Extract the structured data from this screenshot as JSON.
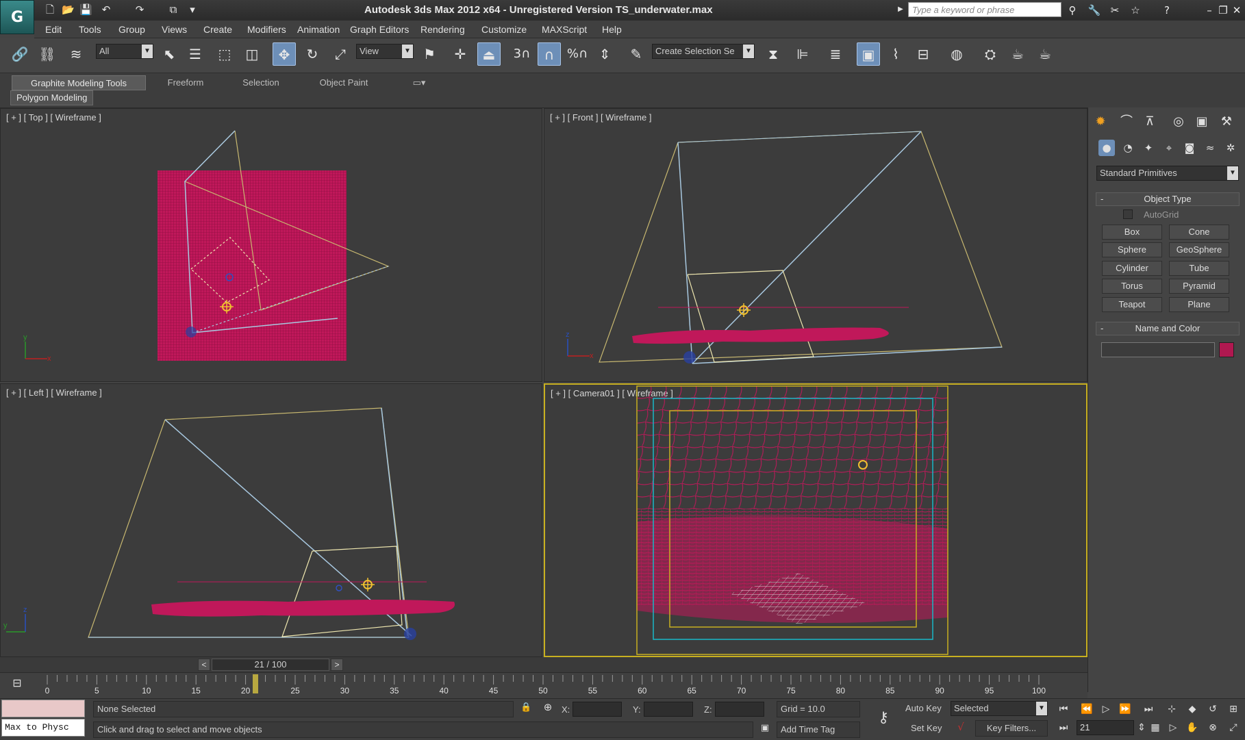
{
  "title_bar": {
    "title": "Autodesk 3ds Max  2012 x64  -  Unregistered Version    TS_underwater.max",
    "search_placeholder": "Type a keyword or phrase",
    "logo_text": "G"
  },
  "menu": [
    "Edit",
    "Tools",
    "Group",
    "Views",
    "Create",
    "Modifiers",
    "Animation",
    "Graph Editors",
    "Rendering",
    "Customize",
    "MAXScript",
    "Help"
  ],
  "toolbar": {
    "selection_filter": "All",
    "reference_coord": "View",
    "named_selection_placeholder": "Create Selection Se",
    "snap_label": "3",
    "angle_snap_label": "%"
  },
  "ribbon": {
    "tabs": [
      "Graphite Modeling Tools",
      "Freeform",
      "Selection",
      "Object Paint"
    ],
    "panel": "Polygon Modeling"
  },
  "viewports": {
    "top_label": "[ + ] [ Top ] [ Wireframe ]",
    "front_label": "[ + ] [ Front ] [ Wireframe ]",
    "left_label": "[ + ] [ Left ] [ Wireframe ]",
    "camera_label": "[ + ] [ Camera01 ] [ Wireframe ]",
    "axis_x": "x",
    "axis_y": "y",
    "axis_z": "z"
  },
  "command_panel": {
    "category_dropdown": "Standard Primitives",
    "object_type_title": "Object Type",
    "autogrid_label": "AutoGrid",
    "buttons": [
      "Box",
      "Cone",
      "Sphere",
      "GeoSphere",
      "Cylinder",
      "Tube",
      "Torus",
      "Pyramid",
      "Teapot",
      "Plane"
    ],
    "name_color_title": "Name and Color",
    "color_swatch": "#b01850",
    "collapse_symbol": "-"
  },
  "timeline": {
    "slider_text": "21 / 100",
    "prev_symbol": "<",
    "next_symbol": ">",
    "ticks": [
      "0",
      "5",
      "10",
      "15",
      "20",
      "25",
      "30",
      "35",
      "40",
      "45",
      "50",
      "55",
      "60",
      "65",
      "70",
      "75",
      "80",
      "85",
      "90",
      "95",
      "100"
    ],
    "current_frame": 21
  },
  "status": {
    "maxscript_listener": "Max to Physc",
    "selection_status": "None Selected",
    "prompt": "Click and drag to select and move objects",
    "x_label": "X:",
    "y_label": "Y:",
    "z_label": "Z:",
    "grid": "Grid = 10.0",
    "add_time_tag": "Add Time Tag",
    "auto_key": "Auto Key",
    "set_key": "Set Key",
    "key_mode": "Selected",
    "key_filters": "Key Filters...",
    "frame_field": "21"
  },
  "colors": {
    "mesh": "#c0185a",
    "camera_lines": "#a8c8e0",
    "target_lines": "#c8b870",
    "safe_frame_outer": "#c8b020",
    "safe_frame_mid": "#18b8c8",
    "active_border": "#c8b020"
  }
}
